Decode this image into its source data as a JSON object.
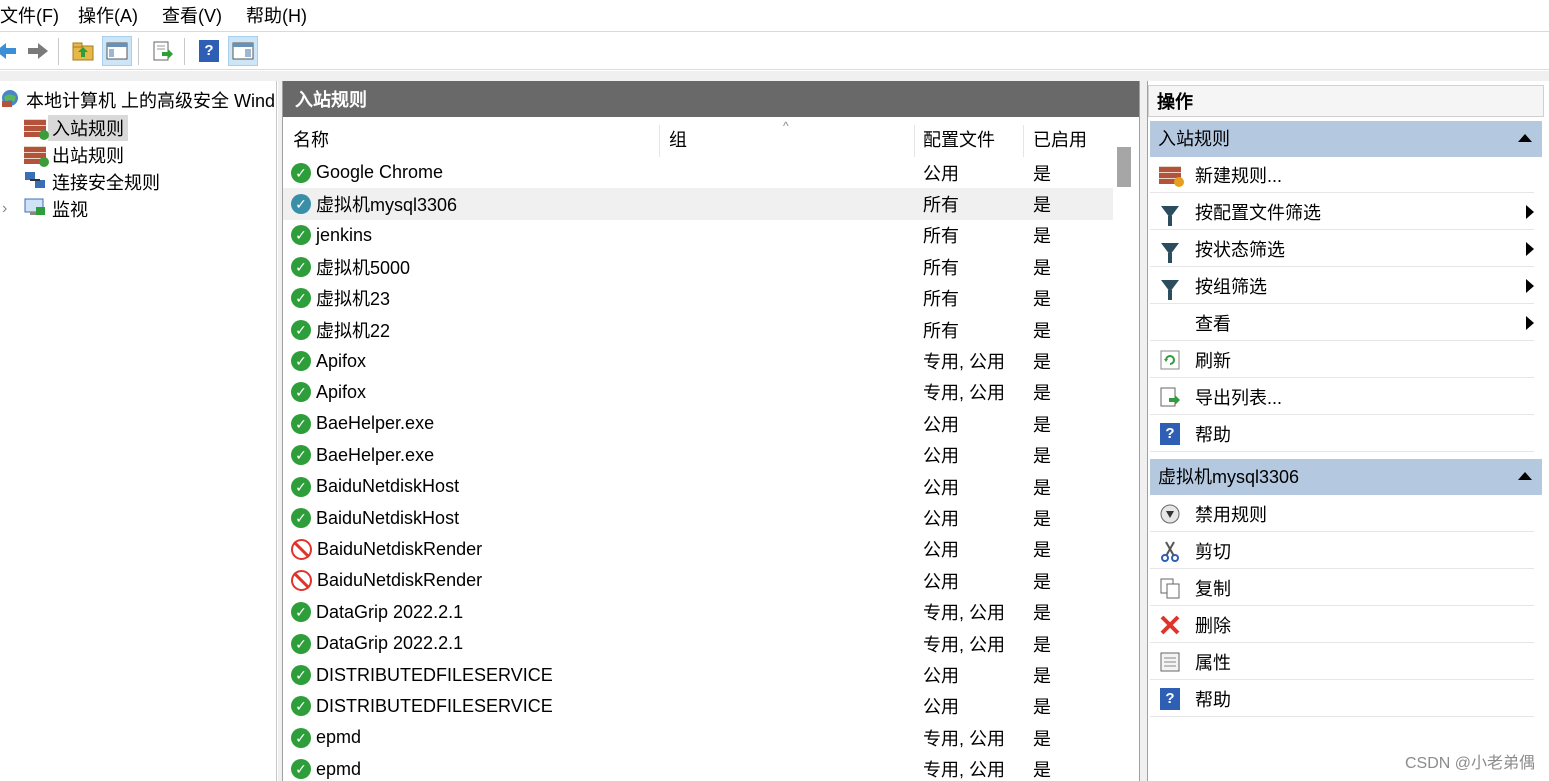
{
  "menu": [
    "文件(F)",
    "操作(A)",
    "查看(V)",
    "帮助(H)"
  ],
  "toolbar": {
    "buttons": [
      "back-icon",
      "forward-icon",
      "up-folder-icon",
      "show-hide-tree-icon",
      "export-list-icon",
      "help-icon",
      "show-hide-action-pane-icon"
    ]
  },
  "tree": {
    "root": "本地计算机 上的高级安全 Wind",
    "items": [
      {
        "label": "入站规则",
        "selected": true
      },
      {
        "label": "出站规则",
        "selected": false
      },
      {
        "label": "连接安全规则",
        "selected": false
      },
      {
        "label": "监视",
        "selected": false
      }
    ],
    "expander": "›"
  },
  "center": {
    "title": "入站规则",
    "columns": {
      "name": "名称",
      "group": "组",
      "profile": "配置文件",
      "enabled": "已启用"
    },
    "sort_indicator": "^",
    "rows": [
      {
        "name": "Google Chrome",
        "profile": "公用",
        "enabled": "是",
        "status": "allow"
      },
      {
        "name": "虚拟机mysql3306",
        "profile": "所有",
        "enabled": "是",
        "status": "allow",
        "selected": true
      },
      {
        "name": "jenkins",
        "profile": "所有",
        "enabled": "是",
        "status": "allow"
      },
      {
        "name": "虚拟机5000",
        "profile": "所有",
        "enabled": "是",
        "status": "allow"
      },
      {
        "name": "虚拟机23",
        "profile": "所有",
        "enabled": "是",
        "status": "allow"
      },
      {
        "name": "虚拟机22",
        "profile": "所有",
        "enabled": "是",
        "status": "allow"
      },
      {
        "name": "Apifox",
        "profile": "专用, 公用",
        "enabled": "是",
        "status": "allow"
      },
      {
        "name": "Apifox",
        "profile": "专用, 公用",
        "enabled": "是",
        "status": "allow"
      },
      {
        "name": "BaeHelper.exe",
        "profile": "公用",
        "enabled": "是",
        "status": "allow"
      },
      {
        "name": "BaeHelper.exe",
        "profile": "公用",
        "enabled": "是",
        "status": "allow"
      },
      {
        "name": "BaiduNetdiskHost",
        "profile": "公用",
        "enabled": "是",
        "status": "allow"
      },
      {
        "name": "BaiduNetdiskHost",
        "profile": "公用",
        "enabled": "是",
        "status": "allow"
      },
      {
        "name": "BaiduNetdiskRender",
        "profile": "公用",
        "enabled": "是",
        "status": "block"
      },
      {
        "name": "BaiduNetdiskRender",
        "profile": "公用",
        "enabled": "是",
        "status": "block"
      },
      {
        "name": "DataGrip 2022.2.1",
        "profile": "专用, 公用",
        "enabled": "是",
        "status": "allow"
      },
      {
        "name": "DataGrip 2022.2.1",
        "profile": "专用, 公用",
        "enabled": "是",
        "status": "allow"
      },
      {
        "name": "DISTRIBUTEDFILESERVICE",
        "profile": "公用",
        "enabled": "是",
        "status": "allow"
      },
      {
        "name": "DISTRIBUTEDFILESERVICE",
        "profile": "公用",
        "enabled": "是",
        "status": "allow"
      },
      {
        "name": "epmd",
        "profile": "专用, 公用",
        "enabled": "是",
        "status": "allow"
      },
      {
        "name": "epmd",
        "profile": "专用, 公用",
        "enabled": "是",
        "status": "allow"
      }
    ]
  },
  "actions": {
    "title": "操作",
    "section1": {
      "label": "入站规则",
      "items": [
        {
          "label": "新建规则...",
          "icon": "new-rule-icon",
          "submenu": false
        },
        {
          "label": "按配置文件筛选",
          "icon": "filter-icon",
          "submenu": true
        },
        {
          "label": "按状态筛选",
          "icon": "filter-icon",
          "submenu": true
        },
        {
          "label": "按组筛选",
          "icon": "filter-icon",
          "submenu": true
        },
        {
          "label": "查看",
          "icon": "",
          "submenu": true
        },
        {
          "label": "刷新",
          "icon": "refresh-icon",
          "submenu": false
        },
        {
          "label": "导出列表...",
          "icon": "export-icon",
          "submenu": false
        },
        {
          "label": "帮助",
          "icon": "help-icon",
          "submenu": false
        }
      ]
    },
    "section2": {
      "label": "虚拟机mysql3306",
      "items": [
        {
          "label": "禁用规则",
          "icon": "disable-icon"
        },
        {
          "label": "剪切",
          "icon": "cut-icon"
        },
        {
          "label": "复制",
          "icon": "copy-icon"
        },
        {
          "label": "删除",
          "icon": "delete-icon"
        },
        {
          "label": "属性",
          "icon": "properties-icon"
        },
        {
          "label": "帮助",
          "icon": "help-icon"
        }
      ]
    }
  },
  "watermark": "CSDN @小老弟偶",
  "colors": {
    "section_header": "#b4c9e0",
    "title_bar": "#696969",
    "allow": "#2e9e3a",
    "block": "#e0342b"
  }
}
